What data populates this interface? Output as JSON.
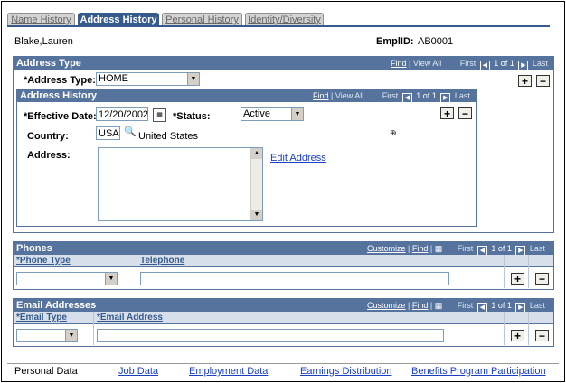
{
  "tabs": [
    {
      "label": "Name History",
      "active": false
    },
    {
      "label": "Address History",
      "active": true
    },
    {
      "label": "Personal History",
      "active": false
    },
    {
      "label": "Identity/Diversity",
      "active": false
    }
  ],
  "employee": {
    "name": "Blake,Lauren",
    "emplid_label": "EmplID:",
    "emplid_value": "AB0001"
  },
  "address_type_section": {
    "title": "Address Type",
    "nav": {
      "find": "Find",
      "view_all": "View All",
      "first": "First",
      "count": "1 of 1",
      "last": "Last"
    },
    "address_type_label": "*Address Type:",
    "address_type_value": "HOME"
  },
  "address_history_section": {
    "title": "Address History",
    "nav": {
      "find": "Find",
      "view_all": "View All",
      "first": "First",
      "count": "1 of 1",
      "last": "Last"
    },
    "effective_date_label": "*Effective Date:",
    "effective_date_value": "12/20/2002",
    "status_label": "*Status:",
    "status_value": "Active",
    "country_label": "Country:",
    "country_code": "USA",
    "country_name": "United States",
    "address_label": "Address:",
    "address_value": "",
    "edit_address_link": "Edit Address"
  },
  "phones_section": {
    "title": "Phones",
    "nav": {
      "customize": "Customize",
      "find": "Find",
      "first": "First",
      "count": "1 of 1",
      "last": "Last"
    },
    "col_phone_type": "*Phone Type",
    "col_telephone": "Telephone",
    "phone_type_value": "",
    "telephone_value": ""
  },
  "email_section": {
    "title": "Email Addresses",
    "nav": {
      "customize": "Customize",
      "find": "Find",
      "first": "First",
      "count": "1 of 1",
      "last": "Last"
    },
    "col_email_type": "*Email Type",
    "col_email_address": "*Email Address",
    "email_type_value": "",
    "email_address_value": ""
  },
  "bottom_links": [
    {
      "label": "Personal Data",
      "is_link": false
    },
    {
      "label": "Job Data",
      "is_link": true
    },
    {
      "label": "Employment Data",
      "is_link": true
    },
    {
      "label": "Earnings Distribution",
      "is_link": true
    },
    {
      "label": "Benefits Program Participation",
      "is_link": true
    }
  ],
  "buttons": {
    "add": "+",
    "remove": "−"
  },
  "icons": {
    "calendar": "calendar-icon",
    "lookup": "magnifier-icon",
    "address_lookup": "address-lookup-icon",
    "first_arrow": "chevron-left-icon",
    "next_arrow": "chevron-right-icon",
    "dropdown": "dropdown-arrow-icon",
    "grid_icon": "grid-view-icon"
  },
  "colors": {
    "header_bg": "#56739d",
    "active_tab": "#365a8c",
    "link": "#1a3fbf"
  }
}
